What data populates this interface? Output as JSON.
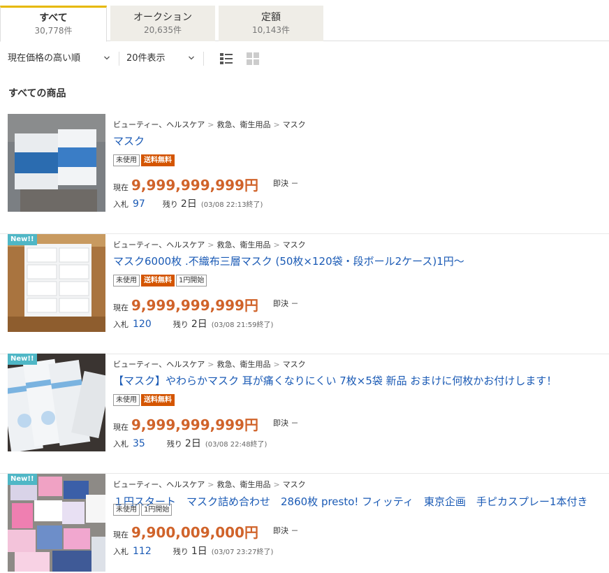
{
  "tabs": [
    {
      "label": "すべて",
      "count": "30,778件",
      "active": true
    },
    {
      "label": "オークション",
      "count": "20,635件",
      "active": false
    },
    {
      "label": "定額",
      "count": "10,143件",
      "active": false
    }
  ],
  "toolbar": {
    "sort_value": "現在価格の高い順",
    "per_page_value": "20件表示"
  },
  "section_title": "すべての商品",
  "labels": {
    "current": "現在",
    "buy_now": "即決",
    "bids": "入札",
    "remaining": "残り",
    "new": "New!!"
  },
  "items": [
    {
      "breadcrumb": [
        "ビューティー、ヘルスケア",
        "救急、衛生用品",
        "マスク"
      ],
      "title": "マスク",
      "badges": [
        "未使用",
        "送料無料"
      ],
      "price": "9,999,999,999円",
      "buy_now_value": "－",
      "bid_count": "97",
      "remaining": "2日",
      "end_time": "(03/08 22:13終了)",
      "is_new": false
    },
    {
      "breadcrumb": [
        "ビューティー、ヘルスケア",
        "救急、衛生用品",
        "マスク"
      ],
      "title": "マスク6000枚 .不織布三層マスク (50枚×120袋・段ボール2ケース)1円～",
      "badges": [
        "未使用",
        "送料無料",
        "1円開始"
      ],
      "price": "9,999,999,999円",
      "buy_now_value": "－",
      "bid_count": "120",
      "remaining": "2日",
      "end_time": "(03/08 21:59終了)",
      "is_new": true
    },
    {
      "breadcrumb": [
        "ビューティー、ヘルスケア",
        "救急、衛生用品",
        "マスク"
      ],
      "title": "【マスク】やわらかマスク 耳が痛くなりにくい 7枚×5袋 新品 おまけに何枚かお付けします！",
      "badges": [
        "未使用",
        "送料無料"
      ],
      "price": "9,999,999,999円",
      "buy_now_value": "－",
      "bid_count": "35",
      "remaining": "2日",
      "end_time": "(03/08 22:48終了)",
      "is_new": true
    },
    {
      "breadcrumb": [
        "ビューティー、ヘルスケア",
        "救急、衛生用品",
        "マスク"
      ],
      "title": "１円スタート　マスク詰め合わせ　2860枚 presto! フィッティ　東京企画　手ピカスプレー1本付き",
      "badges": [
        "未使用",
        "1円開始"
      ],
      "price": "9,900,009,000円",
      "buy_now_value": "－",
      "bid_count": "112",
      "remaining": "1日",
      "end_time": "(03/07 23:27終了)",
      "is_new": true
    }
  ],
  "colors": {
    "accent_tab": "#e6b800",
    "price": "#d0632a",
    "link": "#1a5ab5",
    "shipping_badge": "#d45500",
    "new_badge": "#4fb7c6"
  }
}
